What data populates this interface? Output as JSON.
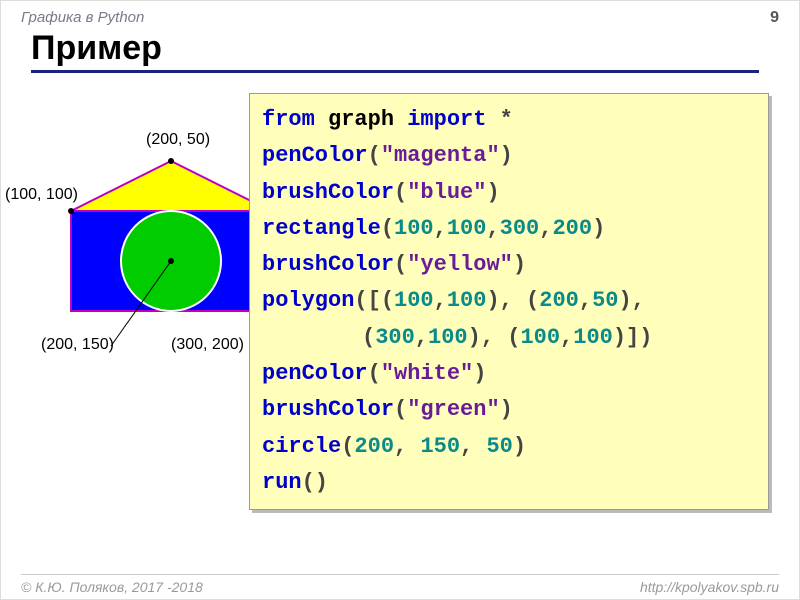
{
  "header": {
    "topic": "Графика в Python",
    "page": "9"
  },
  "title": "Пример",
  "figure": {
    "labels": {
      "top": "(200, 50)",
      "left": "(100, 100)",
      "center": "(200, 150)",
      "br": "(300, 200)"
    }
  },
  "code": {
    "l1_from": "from",
    "l1_mod": " graph ",
    "l1_imp": "import",
    "l1_star": " *",
    "l2_fn": "penColor",
    "l2_str": "\"magenta\"",
    "l3_fn": "brushColor",
    "l3_str": "\"blue\"",
    "l4_fn": "rectangle",
    "l4_n1": "100",
    "l4_n2": "100",
    "l4_n3": "300",
    "l4_n4": "200",
    "l5_fn": "brushColor",
    "l5_str": "\"yellow\"",
    "l6_fn": "polygon",
    "l6_a": "100",
    "l6_b": "100",
    "l6_c": "200",
    "l6_d": "50",
    "l7_a": "300",
    "l7_b": "100",
    "l7_c": "100",
    "l7_d": "100",
    "l8_fn": "penColor",
    "l8_str": "\"white\"",
    "l9_fn": "brushColor",
    "l9_str": "\"green\"",
    "l10_fn": "circle",
    "l10_a": "200",
    "l10_b": "150",
    "l10_c": "50",
    "l11_fn": "run"
  },
  "footer": {
    "left": "© К.Ю. Поляков, 2017 -2018",
    "right": "http://kpolyakov.spb.ru"
  }
}
